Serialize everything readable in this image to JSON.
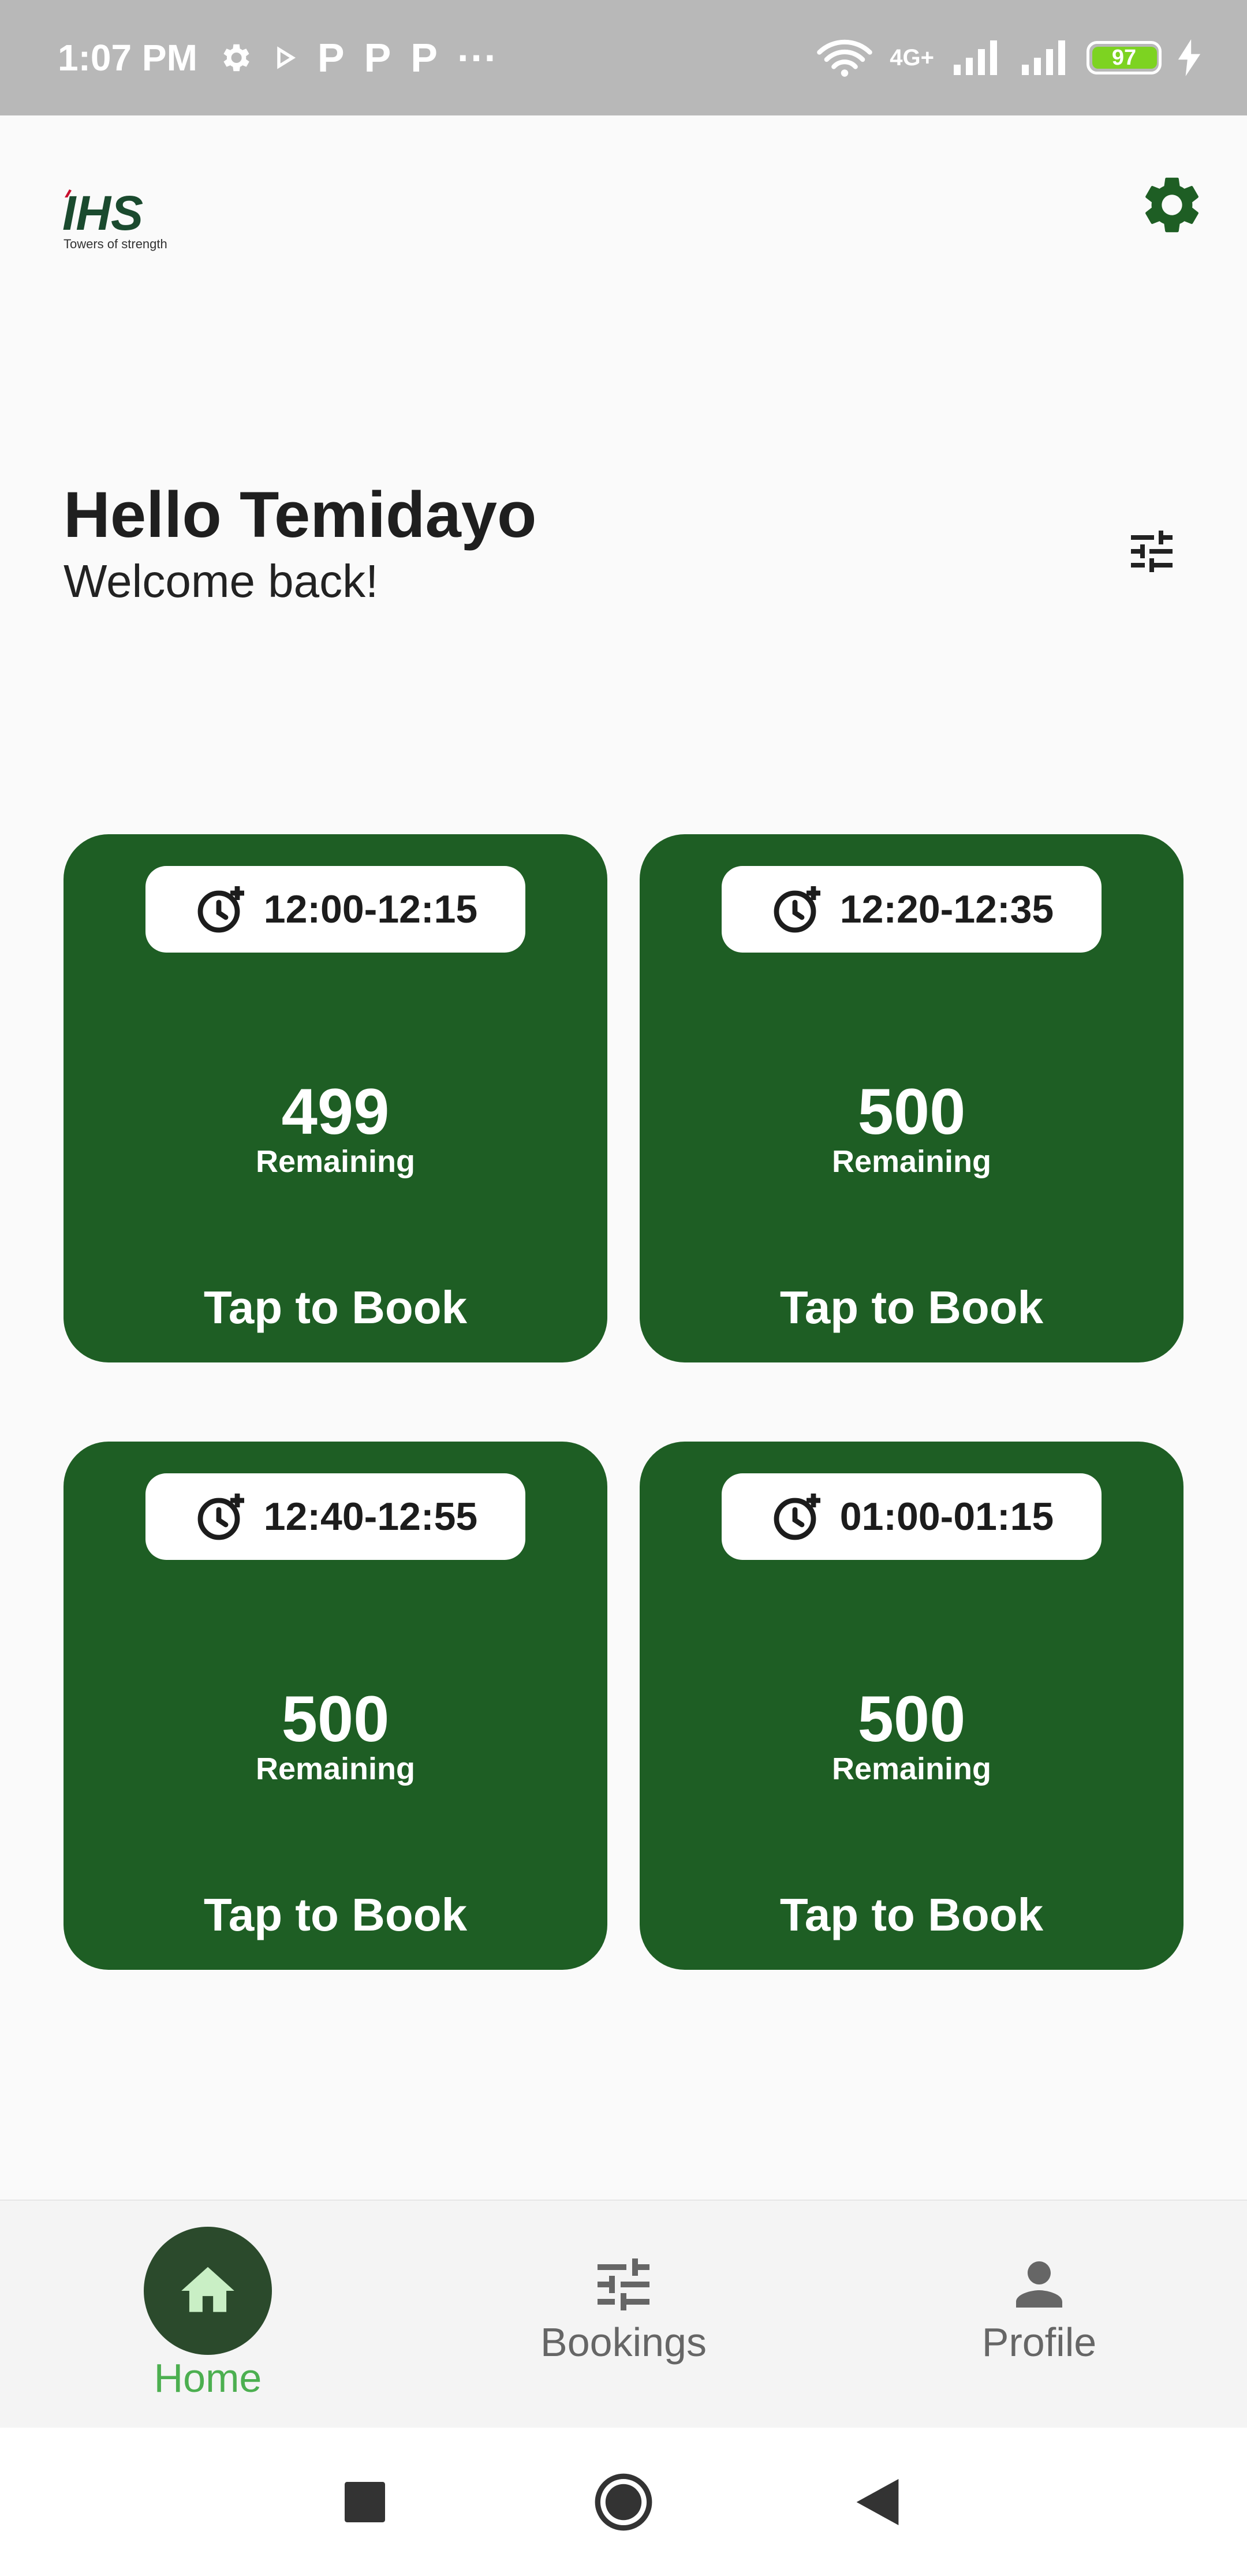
{
  "status_bar": {
    "time": "1:07 PM",
    "notification_icons": [
      "gear-icon",
      "play-icon",
      "p-icon",
      "p-icon",
      "p-icon",
      "more-icon"
    ],
    "network_label": "4G+",
    "battery_level": "97"
  },
  "header": {
    "logo_text": "IHS",
    "logo_tagline": "Towers of strength"
  },
  "greeting": {
    "title": "Hello Temidayo",
    "subtitle": "Welcome back!"
  },
  "slots": [
    {
      "time": "12:00-12:15",
      "remaining": "499",
      "remaining_label": "Remaining",
      "action": "Tap to Book"
    },
    {
      "time": "12:20-12:35",
      "remaining": "500",
      "remaining_label": "Remaining",
      "action": "Tap to Book"
    },
    {
      "time": "12:40-12:55",
      "remaining": "500",
      "remaining_label": "Remaining",
      "action": "Tap to Book"
    },
    {
      "time": "01:00-01:15",
      "remaining": "500",
      "remaining_label": "Remaining",
      "action": "Tap to Book"
    }
  ],
  "bottom_nav": {
    "items": [
      {
        "label": "Home",
        "icon": "home-icon",
        "active": true
      },
      {
        "label": "Bookings",
        "icon": "sliders-icon",
        "active": false
      },
      {
        "label": "Profile",
        "icon": "person-icon",
        "active": false
      }
    ]
  },
  "colors": {
    "card_green": "#1e5e24",
    "accent_green": "#4caf50",
    "settings_icon": "#1e5e24"
  }
}
